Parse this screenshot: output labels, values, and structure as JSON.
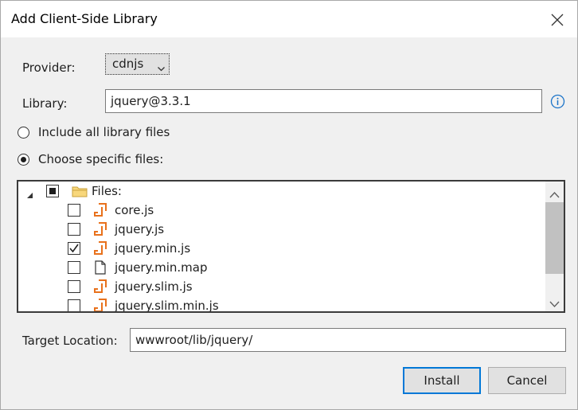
{
  "dialog": {
    "title": "Add Client-Side Library",
    "close_icon": "close-icon"
  },
  "provider": {
    "label": "Provider:",
    "value": "cdnjs"
  },
  "library": {
    "label": "Library:",
    "value": "jquery@3.3.1",
    "info_icon": "info-icon"
  },
  "options": {
    "all_files": {
      "label": "Include all library files",
      "selected": false
    },
    "specific_files": {
      "label": "Choose specific files:",
      "selected": true
    }
  },
  "files_tree": {
    "root": {
      "label": "Files:",
      "state": "partial",
      "expanded": true
    },
    "items": [
      {
        "label": "core.js",
        "checked": false,
        "icon": "js-file-icon"
      },
      {
        "label": "jquery.js",
        "checked": false,
        "icon": "js-file-icon"
      },
      {
        "label": "jquery.min.js",
        "checked": true,
        "icon": "js-file-icon"
      },
      {
        "label": "jquery.min.map",
        "checked": false,
        "icon": "document-icon"
      },
      {
        "label": "jquery.slim.js",
        "checked": false,
        "icon": "js-file-icon"
      },
      {
        "label": "jquery.slim.min.js",
        "checked": false,
        "icon": "js-file-icon"
      }
    ]
  },
  "target": {
    "label": "Target Location:",
    "value": "wwwroot/lib/jquery/"
  },
  "buttons": {
    "install": "Install",
    "cancel": "Cancel"
  },
  "colors": {
    "accent": "#0078d7",
    "js_icon": "#e8711c"
  }
}
